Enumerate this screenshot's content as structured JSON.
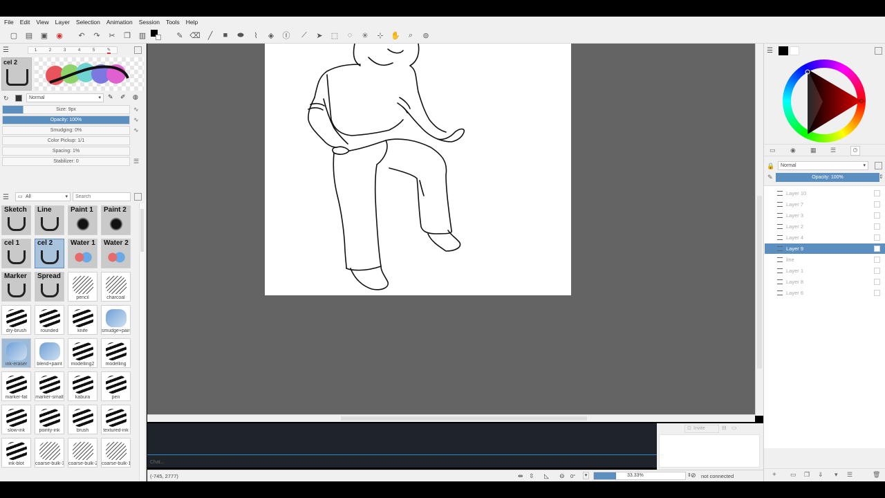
{
  "menu": [
    "File",
    "Edit",
    "View",
    "Layer",
    "Selection",
    "Animation",
    "Session",
    "Tools",
    "Help"
  ],
  "brush": {
    "slot_numbers": [
      "1",
      "2",
      "3",
      "4",
      "5"
    ],
    "preset_name": "cel 2",
    "blend_mode": "Normal",
    "size": "Size: 9px",
    "opacity": "Opacity: 100%",
    "smudging": "Smudging: 0%",
    "color_pickup": "Color Pickup: 1/1",
    "spacing": "Spacing: 1%",
    "stabilizer": "Stabilizer: 0"
  },
  "brush_filter": {
    "category": "All",
    "search_placeholder": "Search"
  },
  "brushes": [
    {
      "label": "Sketch",
      "title": true
    },
    {
      "label": "Line",
      "title": true
    },
    {
      "label": "Paint 1",
      "title": true
    },
    {
      "label": "Paint 2",
      "title": true
    },
    {
      "label": "cel 1",
      "title": true
    },
    {
      "label": "cel 2",
      "title": true,
      "selected": true
    },
    {
      "label": "Water 1",
      "title": true
    },
    {
      "label": "Water 2",
      "title": true
    },
    {
      "label": "Marker",
      "title": true
    },
    {
      "label": "Spread",
      "title": true
    },
    {
      "label": "pencil"
    },
    {
      "label": "charcoal"
    },
    {
      "label": "dry-brush"
    },
    {
      "label": "rounded"
    },
    {
      "label": "knife"
    },
    {
      "label": "smudge+paint"
    },
    {
      "label": "ink-eraser"
    },
    {
      "label": "blend+paint"
    },
    {
      "label": "modelling2"
    },
    {
      "label": "modelling"
    },
    {
      "label": "marker-fat"
    },
    {
      "label": "marker-small"
    },
    {
      "label": "kabura"
    },
    {
      "label": "pen"
    },
    {
      "label": "slow-ink"
    },
    {
      "label": "pointy-ink"
    },
    {
      "label": "brush"
    },
    {
      "label": "textured-ink"
    },
    {
      "label": "ink-blot"
    },
    {
      "label": "coarse-bulk-3"
    },
    {
      "label": "coarse-bulk-2"
    },
    {
      "label": "coarse-bulk-1"
    }
  ],
  "layers_panel": {
    "blend_mode": "Normal",
    "opacity": "Opacity: 100%",
    "layers": [
      "Layer 10",
      "Layer 7",
      "Layer 3",
      "Layer 2",
      "Layer 4",
      "Layer 9",
      "line",
      "Layer 1",
      "Layer 8",
      "Layer 6"
    ],
    "selected_index": 5
  },
  "session": {
    "invite_label": "Invite",
    "chat_placeholder": "Chat..."
  },
  "status": {
    "coordinates": "(-745, 2777)",
    "rotation": "0°",
    "zoom": "33.33%",
    "connection": "not connected"
  },
  "colors": {
    "accent": "#5b8fc0",
    "canvas_bg": "#646464",
    "chat_bg": "#1e2429"
  }
}
